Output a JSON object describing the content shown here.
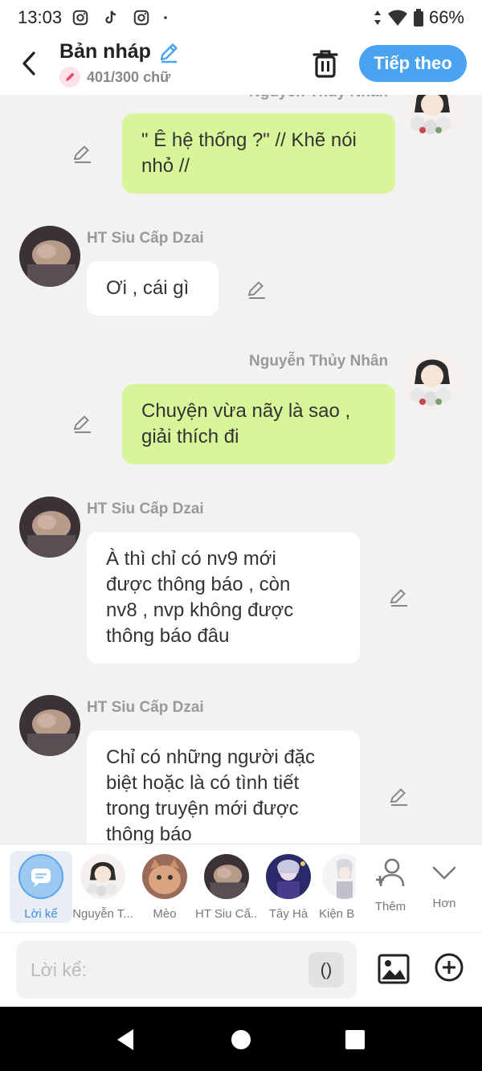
{
  "status": {
    "time": "13:03",
    "battery": "66%"
  },
  "header": {
    "title": "Bản nháp",
    "counter": "401/300 chữ",
    "next_label": "Tiếp theo"
  },
  "messages": [
    {
      "speaker": "Nguyễn Thủy Nhân",
      "text_lines": [
        "\" Ê hệ thống ?\" // Khẽ nói",
        "nhỏ //"
      ],
      "side": "right"
    },
    {
      "speaker": "HT Siu Cấp Dzai",
      "text_lines": [
        "Ơi , cái gì"
      ],
      "side": "left"
    },
    {
      "speaker": "Nguyễn Thủy Nhân",
      "text_lines": [
        "Chuyện vừa nãy là sao ,",
        "giải thích đi"
      ],
      "side": "right"
    },
    {
      "speaker": "HT Siu Cấp Dzai",
      "text_lines": [
        "À thì chỉ có nv9 mới",
        "được thông báo , còn",
        "nv8 , nvp không được",
        "thông báo đâu"
      ],
      "side": "left"
    },
    {
      "speaker": "HT Siu Cấp Dzai",
      "text_lines": [
        "Chỉ có những người đặc",
        "biệt hoặc là có tình tiết",
        "trong truyện mới được",
        "thông báo"
      ],
      "side": "left"
    }
  ],
  "characters": [
    {
      "label": "Lời kể"
    },
    {
      "label": "Nguyễn T..."
    },
    {
      "label": "Mèo"
    },
    {
      "label": "HT Siu Cấ..."
    },
    {
      "label": "Tây Hà"
    },
    {
      "label": "Kiện B"
    },
    {
      "label": "Thêm"
    },
    {
      "label": "Hơn"
    }
  ],
  "composer": {
    "placeholder": "Lời kể:",
    "paren_label": "()"
  }
}
